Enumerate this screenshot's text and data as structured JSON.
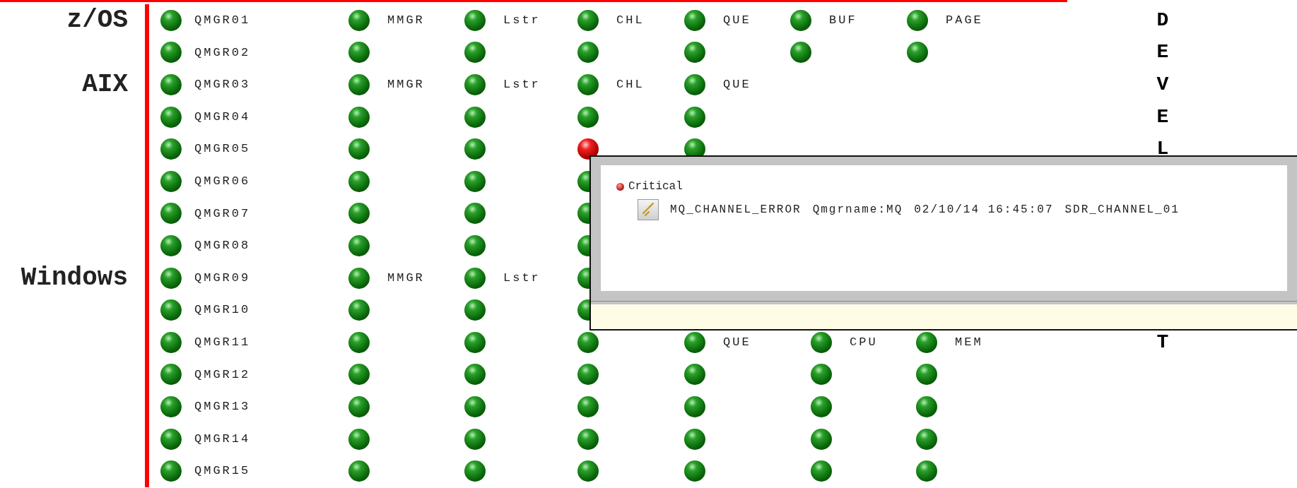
{
  "rows": [
    {
      "os": "z/OS",
      "name": "QMGR01",
      "critical": false,
      "kind": "mainframe",
      "letter": "D",
      "indicators": [
        {
          "critical": false,
          "label": "MMGR"
        },
        {
          "critical": false,
          "label": "Lstr"
        },
        {
          "critical": false,
          "label": "CHL"
        },
        {
          "critical": false,
          "label": "QUE"
        },
        {
          "critical": false,
          "label": "BUF"
        },
        {
          "critical": false,
          "label": "PAGE"
        }
      ]
    },
    {
      "name": "QMGR02",
      "critical": false,
      "kind": "mainframe",
      "letter": "E",
      "indicators": [
        {
          "critical": false
        },
        {
          "critical": false
        },
        {
          "critical": false
        },
        {
          "critical": false
        },
        {
          "critical": false
        },
        {
          "critical": false
        }
      ]
    },
    {
      "os": "AIX",
      "name": "QMGR03",
      "critical": false,
      "kind": "mainframe",
      "letter": "V",
      "indicators": [
        {
          "critical": false,
          "label": "MMGR"
        },
        {
          "critical": false,
          "label": "Lstr"
        },
        {
          "critical": false,
          "label": "CHL"
        },
        {
          "critical": false,
          "label": "QUE"
        }
      ]
    },
    {
      "name": "QMGR04",
      "critical": false,
      "kind": "mainframe",
      "letter": "E",
      "indicators": [
        {
          "critical": false
        },
        {
          "critical": false
        },
        {
          "critical": false
        },
        {
          "critical": false
        }
      ]
    },
    {
      "name": "QMGR05",
      "critical": false,
      "kind": "mainframe",
      "letter": "L",
      "indicators": [
        {
          "critical": false
        },
        {
          "critical": false
        },
        {
          "critical": true
        },
        {
          "critical": false
        }
      ]
    },
    {
      "name": "QMGR06",
      "critical": false,
      "kind": "mainframe",
      "indicators": [
        {
          "critical": false
        },
        {
          "critical": false
        },
        {
          "critical": false
        }
      ]
    },
    {
      "name": "QMGR07",
      "critical": false,
      "kind": "mainframe",
      "indicators": [
        {
          "critical": false
        },
        {
          "critical": false
        },
        {
          "critical": false
        }
      ]
    },
    {
      "name": "QMGR08",
      "critical": false,
      "kind": "mainframe",
      "indicators": [
        {
          "critical": false
        },
        {
          "critical": false
        },
        {
          "critical": false
        }
      ]
    },
    {
      "os": "Windows",
      "name": "QMGR09",
      "critical": false,
      "kind": "distributed",
      "indicators": [
        {
          "critical": false,
          "label": "MMGR"
        },
        {
          "critical": false,
          "label": "Lstr"
        },
        {
          "critical": false
        }
      ]
    },
    {
      "name": "QMGR10",
      "critical": false,
      "kind": "distributed",
      "indicators": [
        {
          "critical": false
        },
        {
          "critical": false
        },
        {
          "critical": false
        }
      ]
    },
    {
      "name": "QMGR11",
      "critical": false,
      "kind": "distributed",
      "letter": "T",
      "indicators": [
        {
          "critical": false
        },
        {
          "critical": false
        },
        {
          "critical": false
        },
        {
          "critical": false,
          "label": "QUE"
        },
        {
          "critical": false,
          "label": "CPU"
        },
        {
          "critical": false,
          "label": "MEM"
        }
      ]
    },
    {
      "name": "QMGR12",
      "critical": false,
      "kind": "distributed",
      "indicators": [
        {
          "critical": false
        },
        {
          "critical": false
        },
        {
          "critical": false
        },
        {
          "critical": false
        },
        {
          "critical": false
        },
        {
          "critical": false
        }
      ]
    },
    {
      "name": "QMGR13",
      "critical": false,
      "kind": "distributed",
      "indicators": [
        {
          "critical": false
        },
        {
          "critical": false
        },
        {
          "critical": false
        },
        {
          "critical": false
        },
        {
          "critical": false
        },
        {
          "critical": false
        }
      ]
    },
    {
      "name": "QMGR14",
      "critical": false,
      "kind": "distributed",
      "indicators": [
        {
          "critical": false
        },
        {
          "critical": false
        },
        {
          "critical": false
        },
        {
          "critical": false
        },
        {
          "critical": false
        },
        {
          "critical": false
        }
      ]
    },
    {
      "name": "QMGR15",
      "critical": false,
      "kind": "distributed",
      "indicators": [
        {
          "critical": false
        },
        {
          "critical": false
        },
        {
          "critical": false
        },
        {
          "critical": false
        },
        {
          "critical": false
        },
        {
          "critical": false
        }
      ]
    }
  ],
  "popup": {
    "severity_label": "Critical",
    "fields": [
      "MQ_CHANNEL_ERROR",
      "Qmgrname:MQ",
      "02/10/14 16:45:07",
      "SDR_CHANNEL_01"
    ]
  }
}
